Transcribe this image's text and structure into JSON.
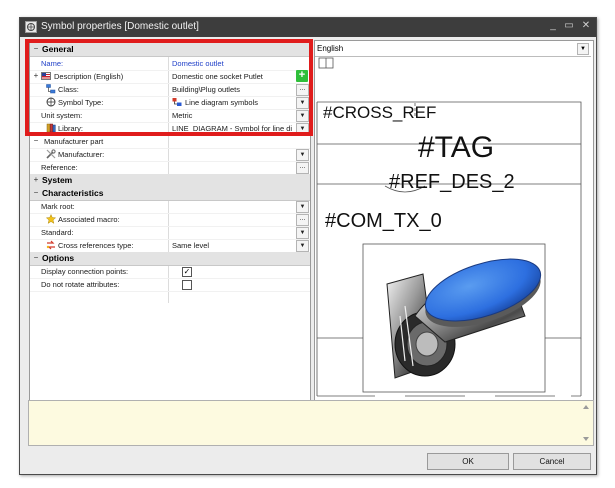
{
  "window": {
    "title": "Symbol properties [Domestic outlet]",
    "minimize": "_",
    "maximize": "▭",
    "close": "✕"
  },
  "properties": {
    "general": {
      "label": "General",
      "name_label": "Name:",
      "name_value": "Domestic outlet",
      "description_label": "Description (English)",
      "description_value": "Domestic one socket Putlet",
      "class_label": "Class:",
      "class_value": "Building\\Plug outlets",
      "symbol_type_label": "Symbol Type:",
      "symbol_type_value": "Line diagram symbols",
      "unit_system_label": "Unit system:",
      "unit_system_value": "Metric",
      "library_label": "Library:",
      "library_value": "LINE_DIAGRAM - Symbol for line di",
      "manufacturer_part_label": "Manufacturer part",
      "manufacturer_label": "Manufacturer:",
      "reference_label": "Reference:"
    },
    "system": {
      "label": "System"
    },
    "characteristics": {
      "label": "Characteristics",
      "mark_root_label": "Mark root:",
      "associated_macro_label": "Associated macro:",
      "standard_label": "Standard:",
      "cross_ref_type_label": "Cross references type:",
      "cross_ref_type_value": "Same level"
    },
    "options": {
      "label": "Options",
      "display_connection_points_label": "Display connection points:",
      "display_connection_points_checked": true,
      "do_not_rotate_label": "Do not rotate attributes:",
      "do_not_rotate_checked": false
    }
  },
  "preview": {
    "language": "English",
    "cross_ref": "#CROSS_REF",
    "tag": "#TAG",
    "ref_des": "#REF_DES_2",
    "com_tx": "#COM_TX_0"
  },
  "buttons": {
    "ok": "OK",
    "cancel": "Cancel"
  },
  "glyphs": {
    "collapse": "−",
    "expand": "+",
    "dropdown": "▼",
    "ellipsis": "...",
    "add": "+",
    "check": "✓",
    "scroll_up": "▲",
    "scroll_down": "▼"
  },
  "colors": {
    "highlight_border": "#e01c1c",
    "link_blue": "#2040c8",
    "add_green": "#2fbf3a",
    "outlet_blue": "#2d6fe0",
    "memo_bg": "#fdfae0"
  }
}
